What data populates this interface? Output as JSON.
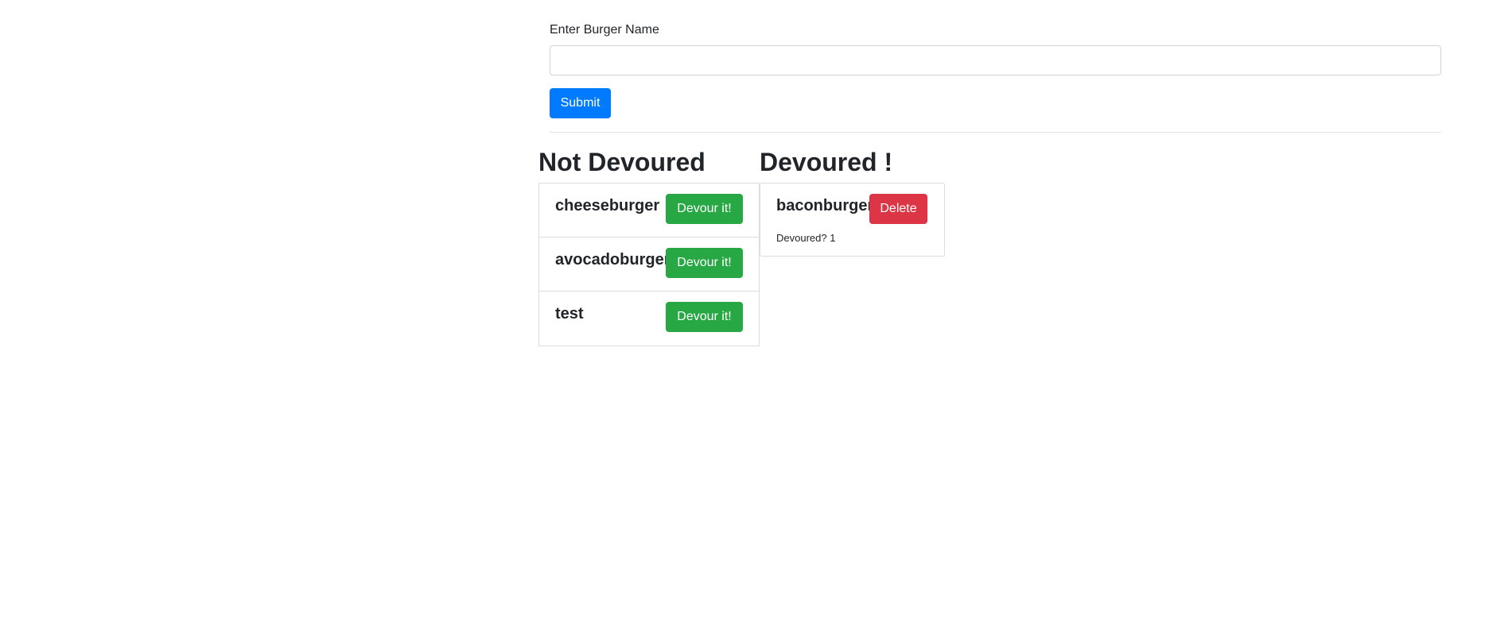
{
  "form": {
    "label": "Enter Burger Name",
    "input_value": "",
    "input_placeholder": "",
    "submit_label": "Submit"
  },
  "not_devoured": {
    "title": "Not Devoured",
    "items": [
      {
        "name": "cheeseburger",
        "button_label": "Devour it!"
      },
      {
        "name": "avocadoburger",
        "button_label": "Devour it!"
      },
      {
        "name": "test",
        "button_label": "Devour it!"
      }
    ]
  },
  "devoured": {
    "title": "Devoured !",
    "items": [
      {
        "name": "baconburger",
        "button_label": "Delete",
        "status_label": "Devoured?",
        "status_value": "1",
        "status_text": "Devoured? 1"
      }
    ]
  },
  "colors": {
    "primary": "#007bff",
    "success": "#28a745",
    "danger": "#dc3545",
    "text": "#212529"
  }
}
